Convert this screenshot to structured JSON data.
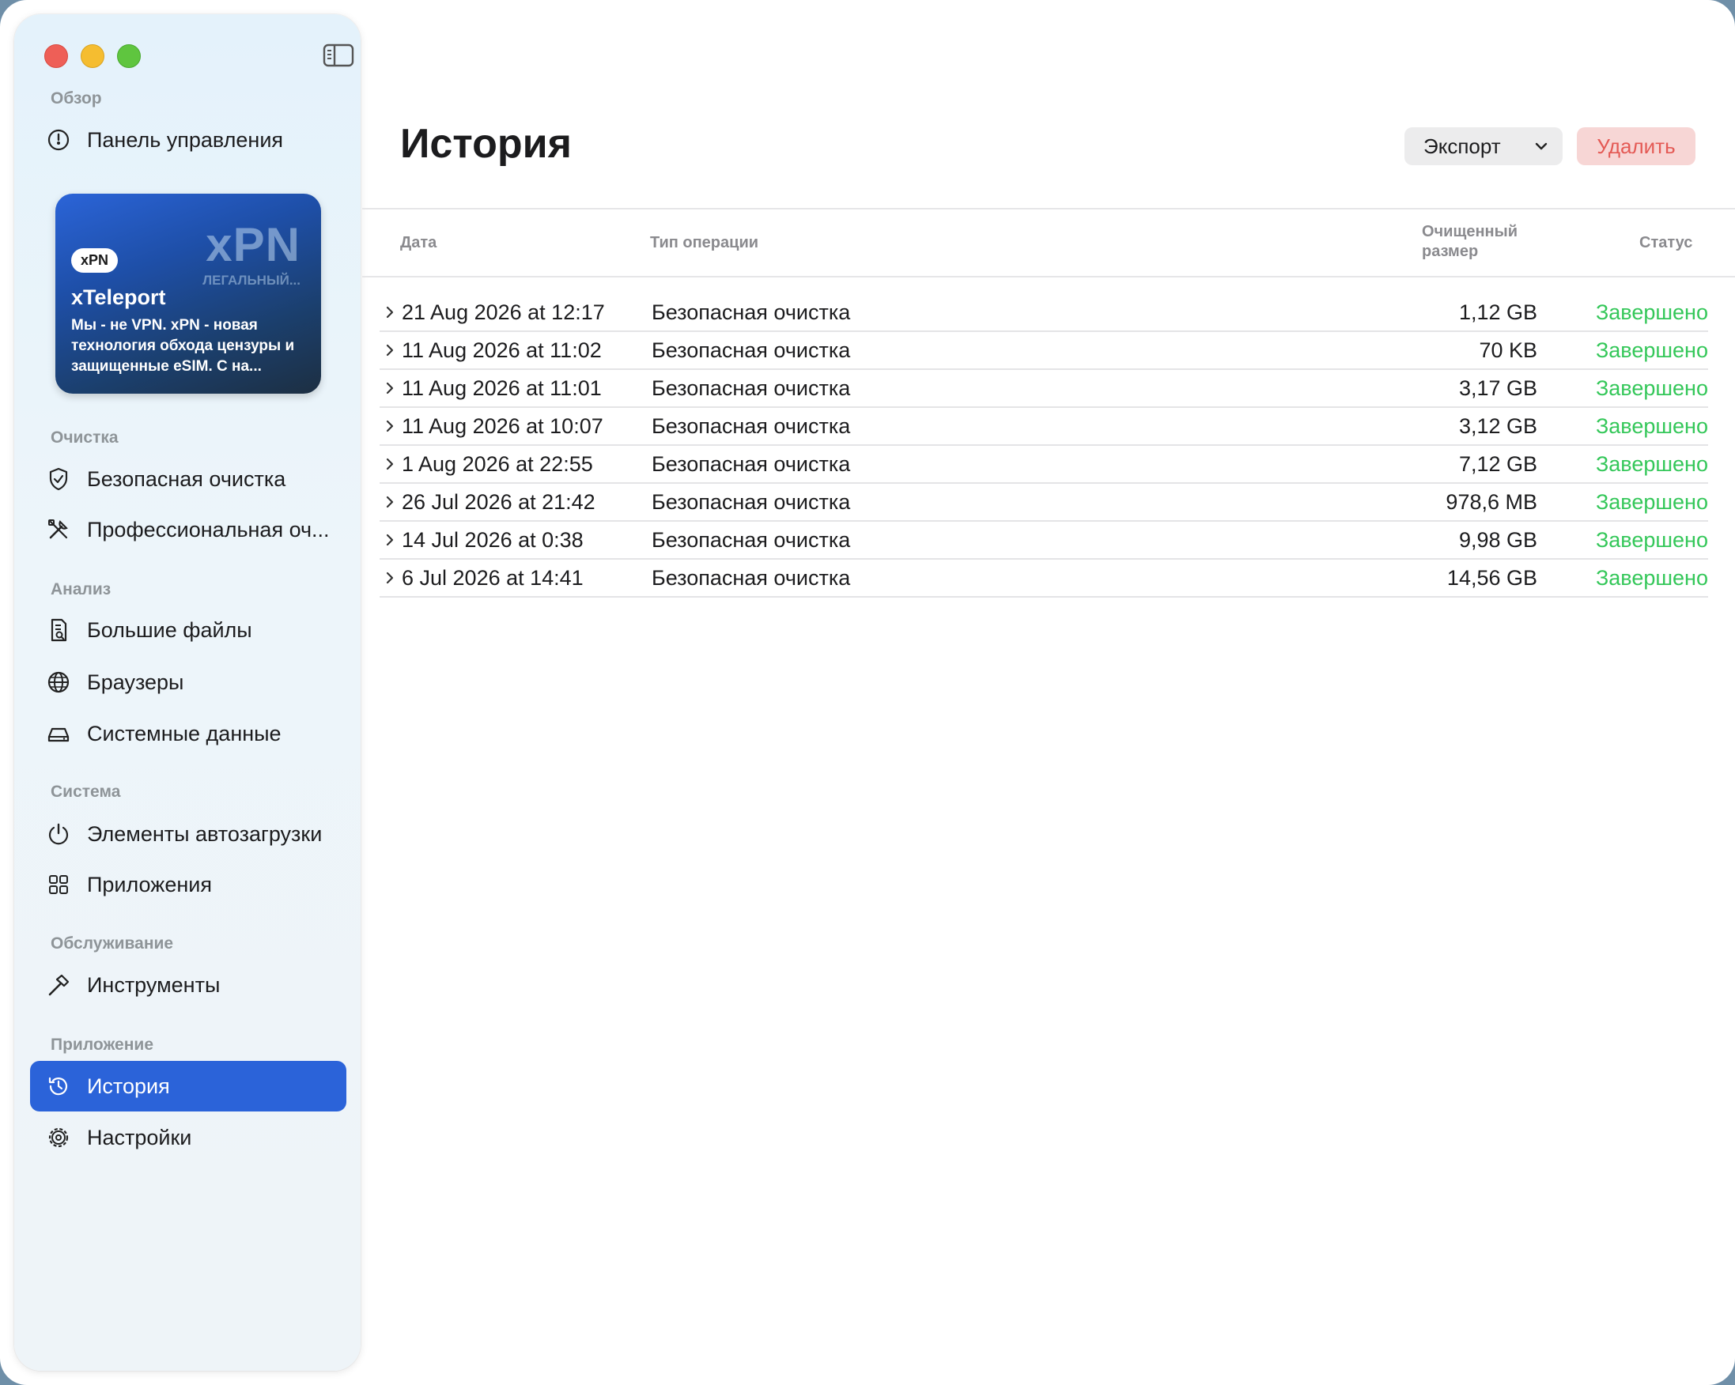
{
  "sidebar": {
    "sections": {
      "overview": "Обзор",
      "cleaning": "Очистка",
      "analysis": "Анализ",
      "system": "Система",
      "maintenance": "Обслуживание",
      "app": "Приложение"
    },
    "items": {
      "dashboard": "Панель управления",
      "safe_clean": "Безопасная очистка",
      "pro_clean": "Профессиональная оч...",
      "large_files": "Большие файлы",
      "browsers": "Браузеры",
      "system_data": "Системные данные",
      "login_items": "Элементы автозагрузки",
      "applications": "Приложения",
      "tools": "Инструменты",
      "history": "История",
      "settings": "Настройки"
    },
    "promo": {
      "logo_text": "xPN",
      "tagline": "ЛЕГАЛЬНЫЙ...",
      "pill": "xPN",
      "name": "xTeleport",
      "description": "Мы - не VPN. xPN - новая технология обхода цензуры и защищенные eSIM. С на..."
    }
  },
  "main": {
    "title": "История",
    "export_label": "Экспорт",
    "delete_label": "Удалить",
    "columns": {
      "date": "Дата",
      "type": "Тип операции",
      "size_line1": "Очищенный",
      "size_line2": "размер",
      "status": "Статус"
    },
    "rows": [
      {
        "date": "21 Aug 2026 at 12:17",
        "type": "Безопасная очистка",
        "size": "1,12 GB",
        "status": "Завершено"
      },
      {
        "date": "11 Aug 2026 at 11:02",
        "type": "Безопасная очистка",
        "size": "70 KB",
        "status": "Завершено"
      },
      {
        "date": "11 Aug 2026 at 11:01",
        "type": "Безопасная очистка",
        "size": "3,17 GB",
        "status": "Завершено"
      },
      {
        "date": "11 Aug 2026 at 10:07",
        "type": "Безопасная очистка",
        "size": "3,12 GB",
        "status": "Завершено"
      },
      {
        "date": "1 Aug 2026 at 22:55",
        "type": "Безопасная очистка",
        "size": "7,12 GB",
        "status": "Завершено"
      },
      {
        "date": "26 Jul 2026 at 21:42",
        "type": "Безопасная очистка",
        "size": "978,6 MB",
        "status": "Завершено"
      },
      {
        "date": "14 Jul 2026 at 0:38",
        "type": "Безопасная очистка",
        "size": "9,98 GB",
        "status": "Завершено"
      },
      {
        "date": "6 Jul 2026 at 14:41",
        "type": "Безопасная очистка",
        "size": "14,56 GB",
        "status": "Завершено"
      }
    ]
  },
  "colors": {
    "accent": "#2b63d9",
    "status_done": "#34c759",
    "delete_text": "#e45a55",
    "delete_bg": "#f7d6d5"
  }
}
